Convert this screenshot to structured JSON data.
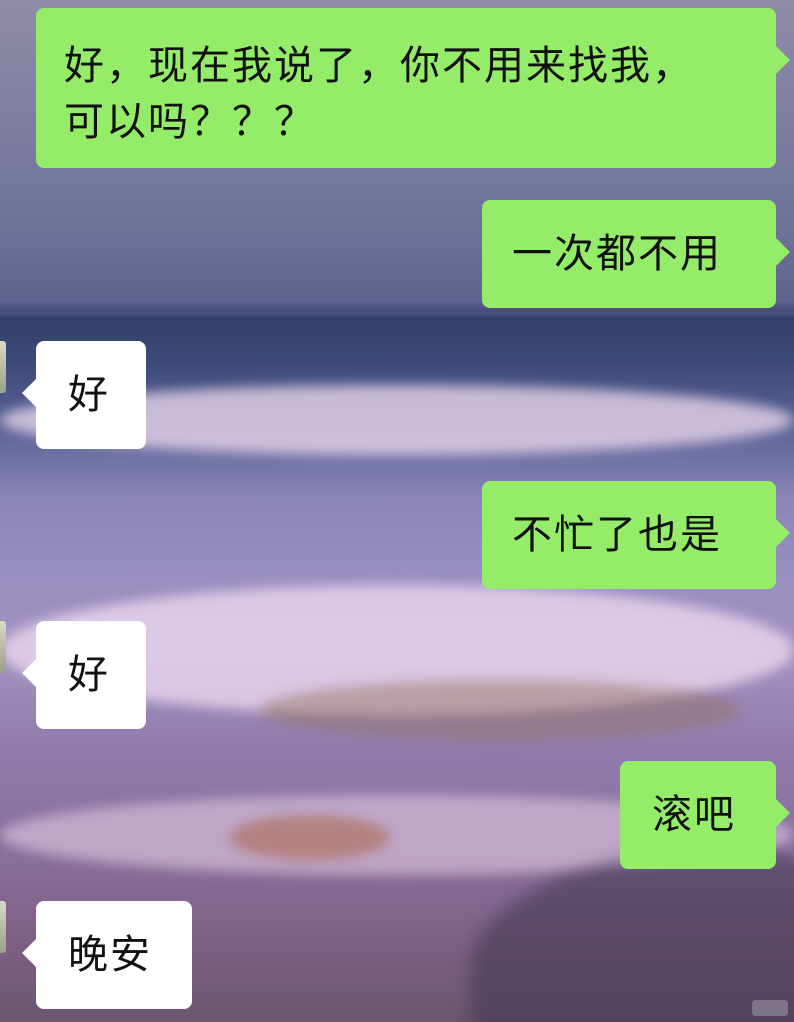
{
  "background": {
    "description_colors": {
      "sky": "#7e7ea0",
      "sea": "#3c4a78",
      "foam": "#f0dcf0",
      "sand": "#7e5f86"
    }
  },
  "colors": {
    "sent_bubble": "#95ec69",
    "received_bubble": "#ffffff",
    "text": "#111111"
  },
  "messages": [
    {
      "side": "sent",
      "lines": [
        "好，现在我说了，你不用来找我，",
        "可以吗？？？"
      ]
    },
    {
      "side": "sent",
      "text": "一次都不用"
    },
    {
      "side": "received",
      "text": "好"
    },
    {
      "side": "sent",
      "text": "不忙了也是"
    },
    {
      "side": "received",
      "text": "好"
    },
    {
      "side": "sent",
      "text": "滚吧"
    },
    {
      "side": "received",
      "text": "晚安"
    }
  ]
}
